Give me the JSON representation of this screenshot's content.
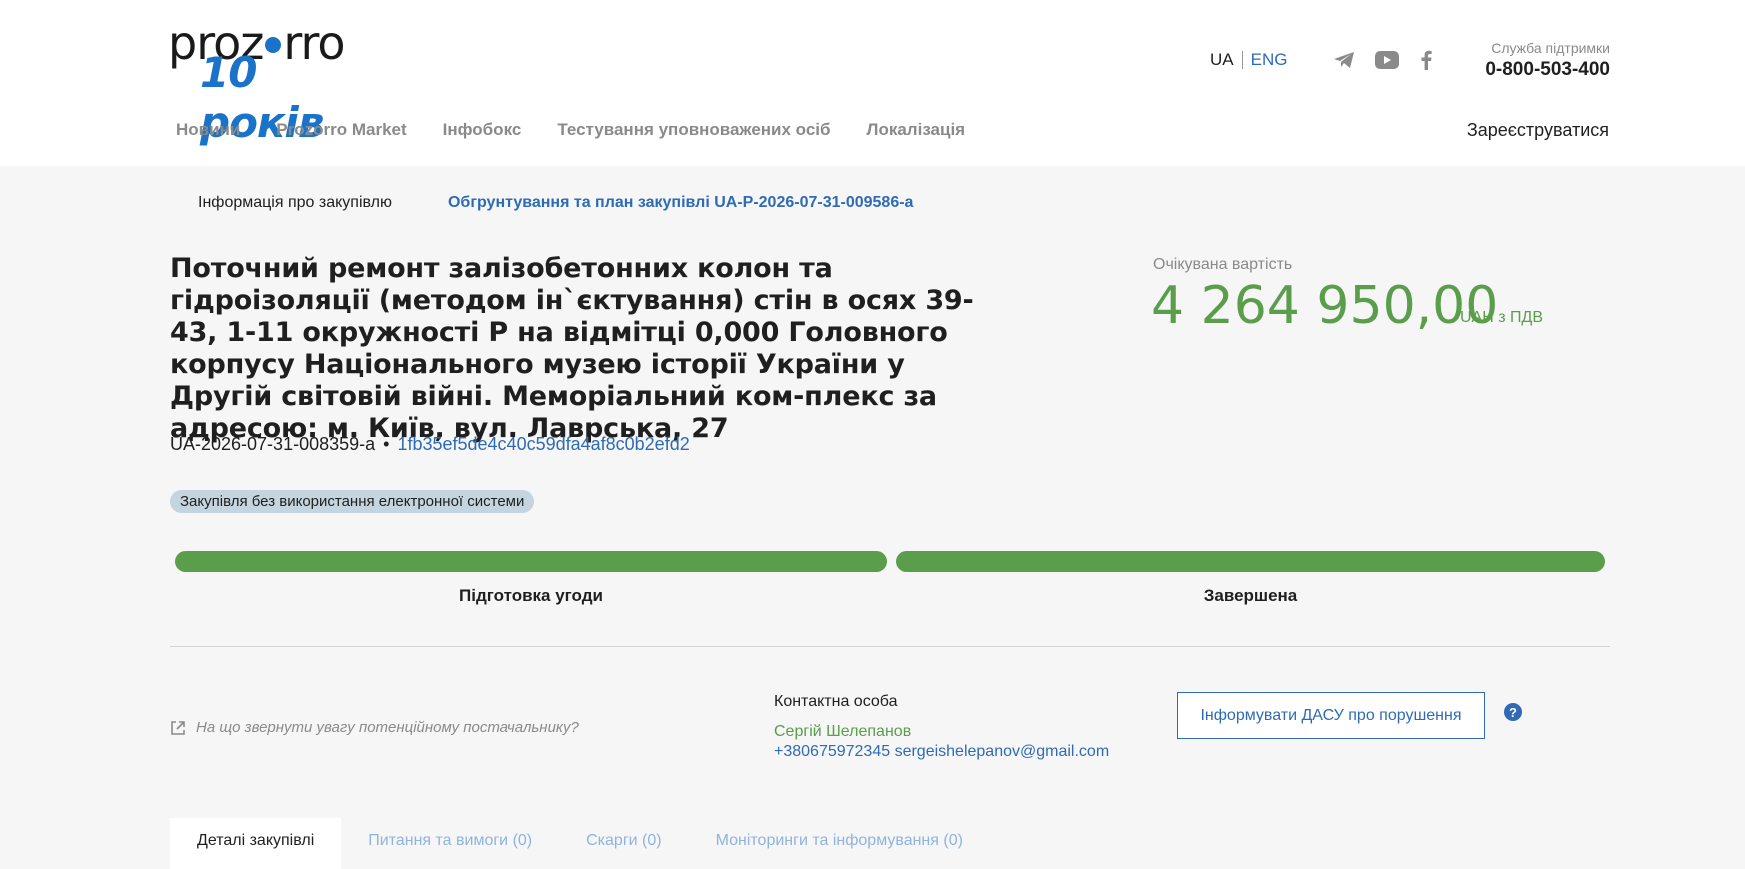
{
  "header": {
    "logo_top": [
      "proz",
      "rro"
    ],
    "logo_bottom": "10 років",
    "lang": {
      "ua": "UA",
      "eng": "ENG"
    },
    "social": [
      "telegram-icon",
      "youtube-icon",
      "facebook-icon"
    ],
    "support_label": "Служба підтримки",
    "support_phone": "0-800-503-400",
    "nav": [
      "Новини",
      "Prozorro Market",
      "Інфобокс",
      "Тестування уповноважених осіб",
      "Локалізація"
    ],
    "register": "Зареєструватися"
  },
  "subnav": {
    "info": "Інформація про закупівлю",
    "plan": "Обгрунтування та план закупівлі UA-P-2026-07-31-009586-a"
  },
  "tender": {
    "title": "Поточний ремонт залізобетонних колон та гідроізоляції (методом ін`єктування) стін в осях 39-43, 1-11 окружності Р на відмітці 0,000 Головного корпусу Національного музею історії України у Другій світовій війні. Меморіальний ком-плекс за адресою: м. Київ, вул. Лаврська, 27",
    "value_label": "Очікувана вартість",
    "value_amount": "4 264 950,00",
    "value_currency": "UAH з ПДВ",
    "id": "UA-2026-07-31-008359-a",
    "id_separator": "•",
    "hash": "1fb35ef5de4c40c59dfa4af8c0b2efd2",
    "badge": "Закупівля без використання електронної системи"
  },
  "stages": [
    {
      "label": "Підготовка угоди",
      "progress": 1.0
    },
    {
      "label": "Завершена",
      "progress": 1.0
    }
  ],
  "hint": "На що звернути увагу потенційному постачальнику?",
  "contact": {
    "label": "Контактна особа",
    "name": "Сергій Шелепанов",
    "info": "+380675972345 sergeishelepanov@gmail.com"
  },
  "dasu_button": "Інформувати ДАСУ про порушення",
  "help_symbol": "?",
  "tabs": [
    "Деталі закупівлі",
    "Питання та вимоги (0)",
    "Скарги (0)",
    "Моніторинги та інформування (0)"
  ],
  "colors": {
    "accent": "#2f6bb5",
    "green": "#5a9e4c",
    "logo_blue": "#1a73c8"
  }
}
